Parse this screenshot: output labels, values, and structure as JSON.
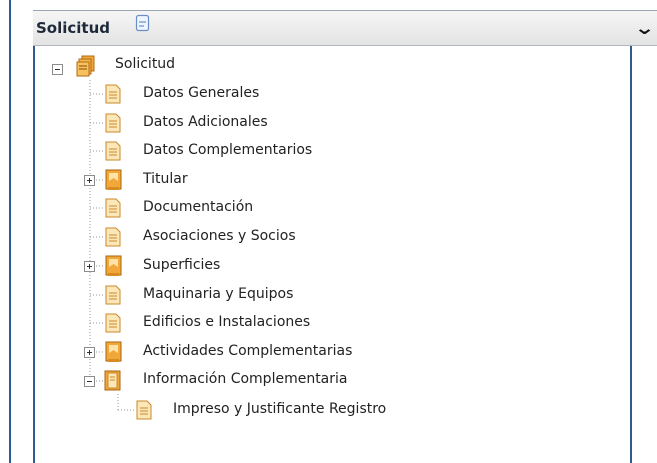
{
  "panel": {
    "title": "Solicitud",
    "collapse_icon": "chevron-down-icon",
    "title_icon": "page-icon"
  },
  "tree": {
    "root": {
      "label": "Solicitud",
      "icon": "folder-stack-icon",
      "expanded": true
    },
    "items": [
      {
        "label": "Datos Generales",
        "type": "leaf",
        "icon": "document-icon"
      },
      {
        "label": "Datos Adicionales",
        "type": "leaf",
        "icon": "document-icon"
      },
      {
        "label": "Datos Complementarios",
        "type": "leaf",
        "icon": "document-icon"
      },
      {
        "label": "Titular",
        "type": "collapsed",
        "icon": "folder-icon"
      },
      {
        "label": "Documentación",
        "type": "leaf",
        "icon": "document-icon"
      },
      {
        "label": "Asociaciones y Socios",
        "type": "leaf",
        "icon": "document-icon"
      },
      {
        "label": "Superficies",
        "type": "collapsed",
        "icon": "folder-icon"
      },
      {
        "label": "Maquinaria y Equipos",
        "type": "leaf",
        "icon": "document-icon"
      },
      {
        "label": "Edificios e Instalaciones",
        "type": "leaf",
        "icon": "document-icon"
      },
      {
        "label": "Actividades Complementarias",
        "type": "collapsed",
        "icon": "folder-icon"
      },
      {
        "label": "Información Complementaria",
        "type": "expanded",
        "icon": "folder-open-icon"
      }
    ],
    "subitems": [
      {
        "label": "Impreso y Justificante Registro",
        "type": "leaf",
        "icon": "document-icon"
      }
    ]
  },
  "colors": {
    "border": "#2f5a96",
    "doc_fill": "#fbe7b8",
    "doc_border": "#c98a2b",
    "folder_fill": "#f2a73a"
  }
}
